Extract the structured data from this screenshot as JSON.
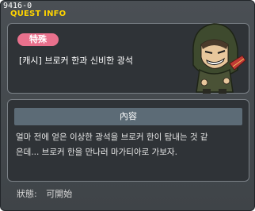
{
  "window": {
    "quest_id": "9416-0",
    "title": "QUEST INFO"
  },
  "quest": {
    "category": "特殊",
    "name": "[캐시] 브로커 한과 신비한 광석",
    "npc_icon": "hooded-broker-npc-icon"
  },
  "content": {
    "header": "內容",
    "lines": [
      "얼마 전에 얻은 이상한 광석을 브로커 한이 탐내는 것 같",
      "은데... 브로커 한을 만나러 마가티아로 가보자."
    ]
  },
  "status": {
    "label": "狀態:",
    "value": "可開始"
  },
  "colors": {
    "title": "#ffd400",
    "badge": "#e9718d",
    "header_bar": "#5c6b76"
  }
}
